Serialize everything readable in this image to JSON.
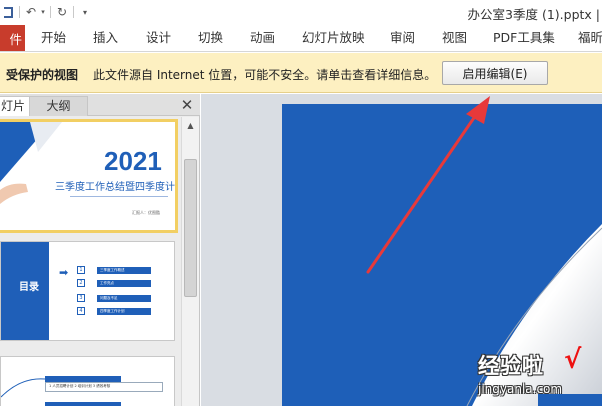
{
  "window": {
    "title": "办公室3季度 (1).pptx |"
  },
  "ribbon": {
    "file_tab": "件",
    "tabs": [
      {
        "label": "开始"
      },
      {
        "label": "插入"
      },
      {
        "label": "设计"
      },
      {
        "label": "切换"
      },
      {
        "label": "动画"
      },
      {
        "label": "幻灯片放映"
      },
      {
        "label": "审阅"
      },
      {
        "label": "视图"
      },
      {
        "label": "PDF工具集"
      },
      {
        "label": "福昕"
      }
    ]
  },
  "protected_view": {
    "title": "受保护的视图",
    "message": "此文件源自 Internet 位置，可能不安全。请单击查看详细信息。",
    "enable_button": "启用编辑(E)"
  },
  "left_pane": {
    "tabs": [
      {
        "label": "灯片"
      },
      {
        "label": "大纲"
      }
    ],
    "close_glyph": "✕"
  },
  "thumbnails": {
    "slide1": {
      "year": "2021",
      "subtitle": "三季度工作总结暨四季度计划",
      "author": "汇报人：优图酷"
    },
    "slide2": {
      "title": "目录",
      "items": [
        {
          "num": "1",
          "text": "三季度工作概述"
        },
        {
          "num": "2",
          "text": "工作亮点"
        },
        {
          "num": "3",
          "text": "问题及不足"
        },
        {
          "num": "4",
          "text": "四季度工作计划"
        }
      ]
    },
    "slide3": {
      "text": "1 人员招聘计划  2 培训计划  3 绩效考核"
    }
  },
  "watermark": {
    "text": "经验啦",
    "check": "√",
    "url": "jingyanla.com"
  },
  "colors": {
    "accent_blue": "#1e5fb8",
    "file_tab_red": "#c83c2c",
    "protected_bar": "#fdf0c1",
    "arrow_red": "#e8393a"
  },
  "icons": [
    "save-icon",
    "undo-icon",
    "redo-icon",
    "qat-customize-icon",
    "close-icon",
    "scroll-up-icon",
    "red-annotation-arrow"
  ]
}
